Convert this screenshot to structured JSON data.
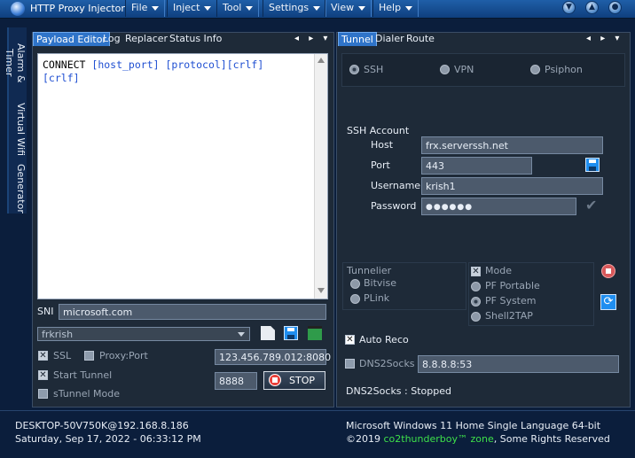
{
  "titlebar": {
    "title": "HTTP Proxy Injector",
    "menus": [
      "File",
      "Inject",
      "Tool",
      "Settings",
      "View",
      "Help"
    ]
  },
  "sidebar": {
    "tabs": [
      "Alarm & Timer",
      "Virtual Wifi",
      "Generator"
    ]
  },
  "left_panel": {
    "tabs": [
      "Payload Editor",
      "Log",
      "Replacer",
      "Status Info"
    ],
    "payload_keyword": "CONNECT",
    "payload_rest": " [host_port] [protocol][crlf]\n[crlf]",
    "sni_label": "SNI",
    "sni_value": "microsoft.com",
    "profile_value": "frkrish",
    "ssl_label": "SSL",
    "proxy_port_label": "Proxy:Port",
    "proxy_value": "123.456.789.012:8080",
    "start_tunnel_label": "Start Tunnel",
    "local_port_value": "8888",
    "stop_label": "STOP",
    "stunnel_label": "sTunnel Mode"
  },
  "right_panel": {
    "tabs": [
      "Tunnel",
      "Dialer",
      "Route"
    ],
    "modes": [
      "SSH",
      "VPN",
      "Psiphon"
    ],
    "ssh_section_label": "SSH Account",
    "host_label": "Host",
    "host_value": "frx.serverssh.net",
    "port_label": "Port",
    "port_value": "443",
    "username_label": "Username",
    "username_value": "krish1",
    "password_label": "Password",
    "password_value": "●●●●●●",
    "tunnelier_label": "Tunnelier",
    "bitvise_label": "Bitvise",
    "plink_label": "PLink",
    "mode_label": "Mode",
    "pf_portable_label": "PF Portable",
    "pf_system_label": "PF System",
    "shell2tap_label": "Shell2TAP",
    "auto_reco_label": "Auto Reco",
    "dns2socks_label": "DNS2Socks",
    "dns_value": "8.8.8.8:53",
    "dns_status": "DNS2Socks : Stopped"
  },
  "statusbar": {
    "host": "DESKTOP-50V750K@192.168.8.186",
    "datetime": "Saturday, Sep 17, 2022 - 06:33:12 PM",
    "os": "Microsoft Windows 11 Home Single Language 64-bit",
    "copyright_prefix": "©2019",
    "copyright_brand": "co2thunderboy™ zone",
    "copyright_suffix": ", Some Rights Reserved"
  },
  "colors": {
    "accent": "#2f74c9",
    "brand_green": "#3ee04a",
    "payload_blue": "#1f4fd2"
  }
}
